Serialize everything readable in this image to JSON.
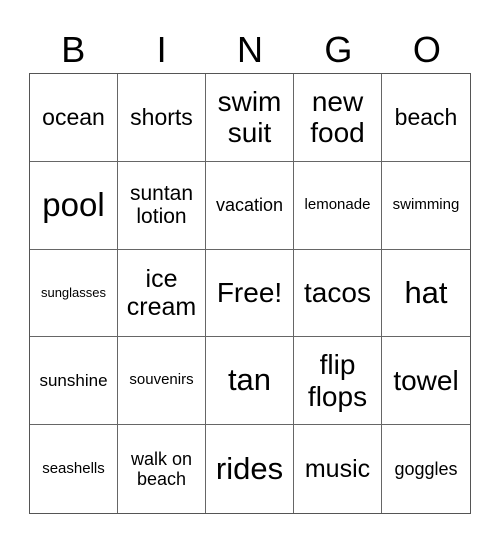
{
  "header": [
    "B",
    "I",
    "N",
    "G",
    "O"
  ],
  "cells": [
    "ocean",
    "shorts",
    "swim suit",
    "new food",
    "beach",
    "pool",
    "suntan lotion",
    "vacation",
    "lemonade",
    "swimming",
    "sunglasses",
    "ice cream",
    "Free!",
    "tacos",
    "hat",
    "sunshine",
    "souvenirs",
    "tan",
    "flip flops",
    "towel",
    "seashells",
    "walk on beach",
    "rides",
    "music",
    "goggles"
  ]
}
